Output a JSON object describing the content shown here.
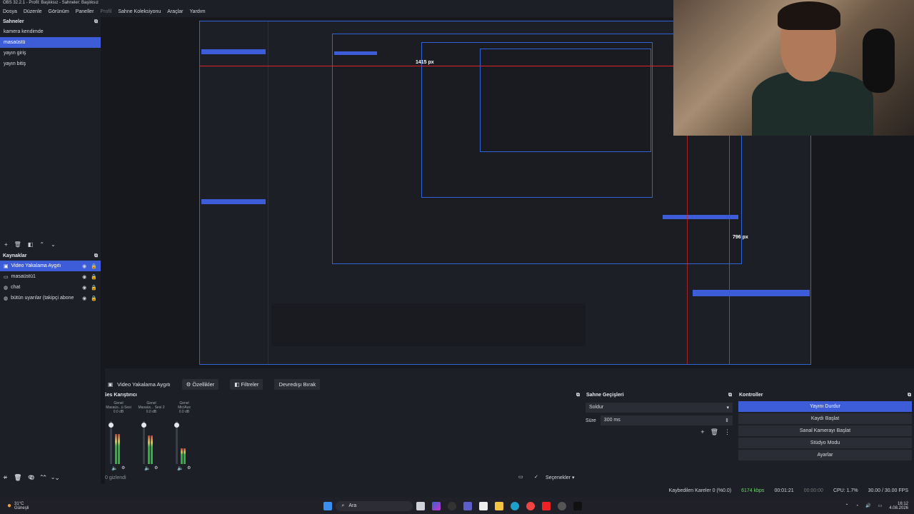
{
  "window": {
    "title": "OBS 32.2.1 - Profil: Başlıksız - Sahneler: Başlıksız"
  },
  "menu": [
    {
      "label": "Dosya",
      "enabled": true
    },
    {
      "label": "Düzenle",
      "enabled": true
    },
    {
      "label": "Görünüm",
      "enabled": true
    },
    {
      "label": "Paneller",
      "enabled": true
    },
    {
      "label": "Profil",
      "enabled": false
    },
    {
      "label": "Sahne Koleksiyonu",
      "enabled": true
    },
    {
      "label": "Araçlar",
      "enabled": true
    },
    {
      "label": "Yardım",
      "enabled": true
    }
  ],
  "scenes": {
    "title": "Sahneler",
    "items": [
      "kamera kendimde",
      "masaüstü",
      "yayın giriş",
      "yayın bitiş"
    ],
    "selected": 1
  },
  "sources": {
    "title": "Kaynaklar",
    "items": [
      "Video Yakalama Aygıtı",
      "masaüstü1",
      "chat",
      "bütün uyarılar (takipçi abone"
    ],
    "selected": 0
  },
  "preview": {
    "measure_h": "1415 px",
    "measure_v": "796 px"
  },
  "source_bar": {
    "source_name": "Video Yakalama Aygıtı",
    "properties": "Özellikler",
    "filters": "Filtreler",
    "deactivate": "Devredışı Bırak"
  },
  "mixer": {
    "title": "Ses Karıştırıcı",
    "channels": [
      {
        "group": "Genel",
        "name": "Masaüs...ü Sesi",
        "db": "0.0 dB",
        "level": 0.7
      },
      {
        "group": "Genel",
        "name": "Masaüs... Sesi 2",
        "db": "0.0 dB",
        "level": 0.65
      },
      {
        "group": "Genel",
        "name": "Mic/Aux",
        "db": "0.0 dB",
        "level": 0.4
      }
    ],
    "hidden_count": "0 gizlendi"
  },
  "transitions": {
    "title": "Sahne Geçişleri",
    "type": "Soldur",
    "duration_label": "Süre",
    "duration": "300 ms",
    "options": "Seçenekler"
  },
  "controls": {
    "title": "Kontroller",
    "buttons": [
      "Yayını Durdur",
      "Kaydı Başlat",
      "Sanal Kamerayı Başlat",
      "Stüdyo Modu",
      "Ayarlar"
    ]
  },
  "status": {
    "dropped": "Kaybedilen Kareler 0 (%0.0)",
    "bitrate": "6174 kbps",
    "stream_time": "00:01:21",
    "rec_time": "00:00:00",
    "cpu": "CPU: 1.7%",
    "fps": "30.00 / 30.00 FPS"
  },
  "taskbar": {
    "weather_temp": "31°C",
    "weather_text": "Güneşli",
    "search": "Ara",
    "time": "16:12",
    "date": "4.08.2026"
  },
  "colors": {
    "accent": "#3c5cd8",
    "bg": "#1d1f26",
    "preview_border": "#2f64d8",
    "measure_line": "#e0222a"
  }
}
